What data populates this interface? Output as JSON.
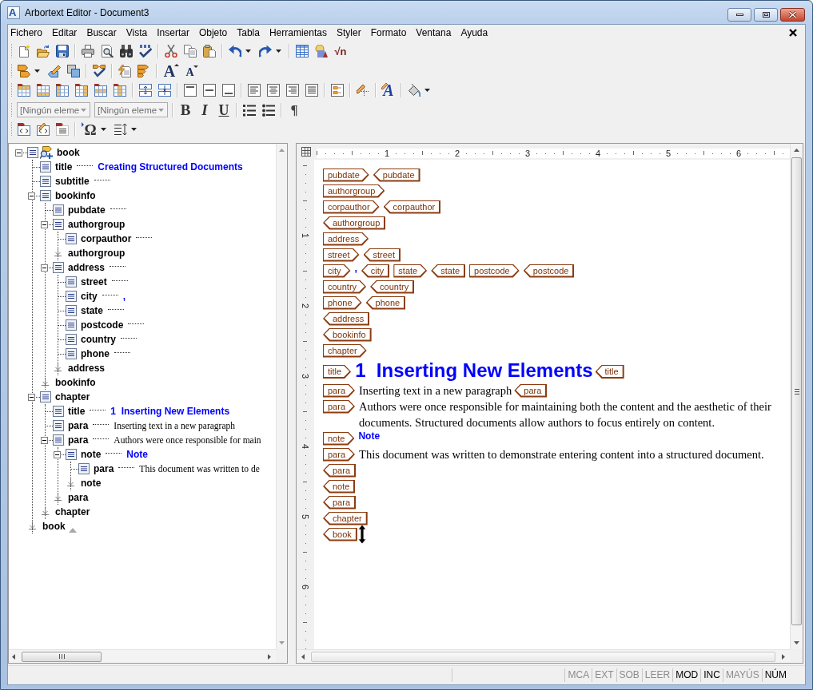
{
  "window": {
    "logo_letter": "A",
    "title": "Arbortext Editor - Document3"
  },
  "menu_bar": [
    "Fichero",
    "Editar",
    "Buscar",
    "Vista",
    "Insertar",
    "Objeto",
    "Tabla",
    "Herramientas",
    "Styler",
    "Formato",
    "Ventana",
    "Ayuda"
  ],
  "toolbars": {
    "equation_button": "√n",
    "grow_font_button": "A",
    "shrink_font_button": "A",
    "text_style_button": "A",
    "element_selects": [
      {
        "value": "[Ningún eleme",
        "disabled": true
      },
      {
        "value": "[Ningún eleme",
        "disabled": true
      }
    ],
    "bold_button": "B",
    "italic_button": "I",
    "underline_button": "U",
    "show_tags_button": "¶",
    "special_character_button": "Ω"
  },
  "tree": {
    "root": {
      "name": "book",
      "expanded": true,
      "leader": false,
      "children": [
        {
          "name": "title",
          "leader": true,
          "value": {
            "kind": "title",
            "text": "Creating Structured Documents"
          }
        },
        {
          "name": "subtitle",
          "leader": true
        },
        {
          "name": "bookinfo",
          "expanded": true,
          "leader": false,
          "children": [
            {
              "name": "pubdate",
              "leader": true
            },
            {
              "name": "authorgroup",
              "expanded": true,
              "leader": false,
              "children": [
                {
                  "name": "corpauthor",
                  "leader": true
                }
              ],
              "end_label": "authorgroup"
            },
            {
              "name": "address",
              "expanded": true,
              "leader": true,
              "children": [
                {
                  "name": "street",
                  "leader": true
                },
                {
                  "name": "city",
                  "leader": true,
                  "value": {
                    "kind": "title",
                    "text": ","
                  }
                },
                {
                  "name": "state",
                  "leader": true
                },
                {
                  "name": "postcode",
                  "leader": true
                },
                {
                  "name": "country",
                  "leader": true
                },
                {
                  "name": "phone",
                  "leader": true
                }
              ],
              "end_label": "address"
            }
          ],
          "end_label": "bookinfo"
        },
        {
          "name": "chapter",
          "expanded": true,
          "leader": false,
          "children": [
            {
              "name": "title",
              "leader": true,
              "value": {
                "kind": "title",
                "text": "1  Inserting New Elements"
              }
            },
            {
              "name": "para",
              "leader": true,
              "value": {
                "kind": "text",
                "text": "Inserting text in a new paragraph"
              }
            },
            {
              "name": "para",
              "expanded": true,
              "leader": true,
              "value": {
                "kind": "text",
                "text": "Authors were once responsible for main"
              },
              "children": [
                {
                  "name": "note",
                  "expanded": true,
                  "leader": true,
                  "value": {
                    "kind": "title",
                    "text": "Note"
                  },
                  "children": [
                    {
                      "name": "para",
                      "leader": true,
                      "value": {
                        "kind": "text",
                        "text": "This document was written to de"
                      }
                    }
                  ],
                  "end_label": "note"
                }
              ],
              "end_label": "para"
            }
          ],
          "end_label": "chapter"
        }
      ],
      "end_label": "book"
    }
  },
  "editor": {
    "ruler": {
      "horizontal": [
        "1",
        "2",
        "3",
        "4",
        "5",
        "6"
      ],
      "vertical": [
        "1",
        "2",
        "3",
        "4",
        "5",
        "6"
      ]
    },
    "lines": [
      [
        {
          "kind": "start_tag",
          "text": "pubdate"
        },
        {
          "kind": "end_tag",
          "text": "pubdate"
        }
      ],
      [
        {
          "kind": "start_tag",
          "text": "authorgroup"
        }
      ],
      [
        {
          "kind": "start_tag",
          "text": "corpauthor"
        },
        {
          "kind": "end_tag",
          "text": "corpauthor"
        }
      ],
      [
        {
          "kind": "end_tag",
          "text": "authorgroup"
        }
      ],
      [
        {
          "kind": "start_tag",
          "text": "address"
        }
      ],
      [
        {
          "kind": "start_tag",
          "text": "street"
        },
        {
          "kind": "end_tag",
          "text": "street"
        }
      ],
      [
        {
          "kind": "start_tag",
          "text": "city"
        },
        {
          "kind": "inline",
          "text": ","
        },
        {
          "kind": "end_tag",
          "text": "city"
        },
        {
          "kind": "start_tag",
          "text": "state"
        },
        {
          "kind": "end_tag",
          "text": "state"
        },
        {
          "kind": "start_tag",
          "text": "postcode"
        },
        {
          "kind": "end_tag",
          "text": "postcode"
        }
      ],
      [
        {
          "kind": "start_tag",
          "text": "country"
        },
        {
          "kind": "end_tag",
          "text": "country"
        }
      ],
      [
        {
          "kind": "start_tag",
          "text": "phone"
        },
        {
          "kind": "end_tag",
          "text": "phone"
        }
      ],
      [
        {
          "kind": "end_tag",
          "text": "address"
        }
      ],
      [
        {
          "kind": "end_tag",
          "text": "bookinfo"
        }
      ],
      [
        {
          "kind": "start_tag",
          "text": "chapter"
        }
      ],
      [
        {
          "kind": "start_tag",
          "text": "title"
        },
        {
          "kind": "heading",
          "text": "1  Inserting New Elements"
        },
        {
          "kind": "end_tag",
          "text": "title"
        }
      ],
      [
        {
          "kind": "start_tag",
          "text": "para"
        },
        {
          "kind": "body",
          "text": "Inserting text in a new paragraph"
        },
        {
          "kind": "end_tag",
          "text": "para"
        }
      ],
      [
        {
          "kind": "start_tag",
          "text": "para"
        },
        {
          "kind": "body",
          "text": "Authors were once responsible for maintaining both the content and the aesthetic of their documents. Structured documents allow authors to focus entirely on content."
        }
      ],
      [
        {
          "kind": "start_tag",
          "text": "note"
        },
        {
          "kind": "inline",
          "text": "Note"
        }
      ],
      [
        {
          "kind": "start_tag",
          "text": "para"
        },
        {
          "kind": "body",
          "text": "This document was written to demonstrate entering content into a structured document."
        }
      ],
      [
        {
          "kind": "end_tag",
          "text": "para"
        }
      ],
      [
        {
          "kind": "end_tag",
          "text": "note"
        }
      ],
      [
        {
          "kind": "end_tag",
          "text": "para"
        }
      ],
      [
        {
          "kind": "end_tag",
          "text": "chapter"
        }
      ],
      [
        {
          "kind": "end_tag",
          "text": "book"
        }
      ]
    ]
  },
  "status_bar": {
    "indicators": [
      {
        "label": "MCA",
        "on": false
      },
      {
        "label": "EXT",
        "on": false
      },
      {
        "label": "SOB",
        "on": false
      },
      {
        "label": "LEER",
        "on": false
      },
      {
        "label": "MOD",
        "on": true
      },
      {
        "label": "INC",
        "on": true
      },
      {
        "label": "MAYÚS",
        "on": false
      },
      {
        "label": "NÚM",
        "on": true
      }
    ]
  }
}
